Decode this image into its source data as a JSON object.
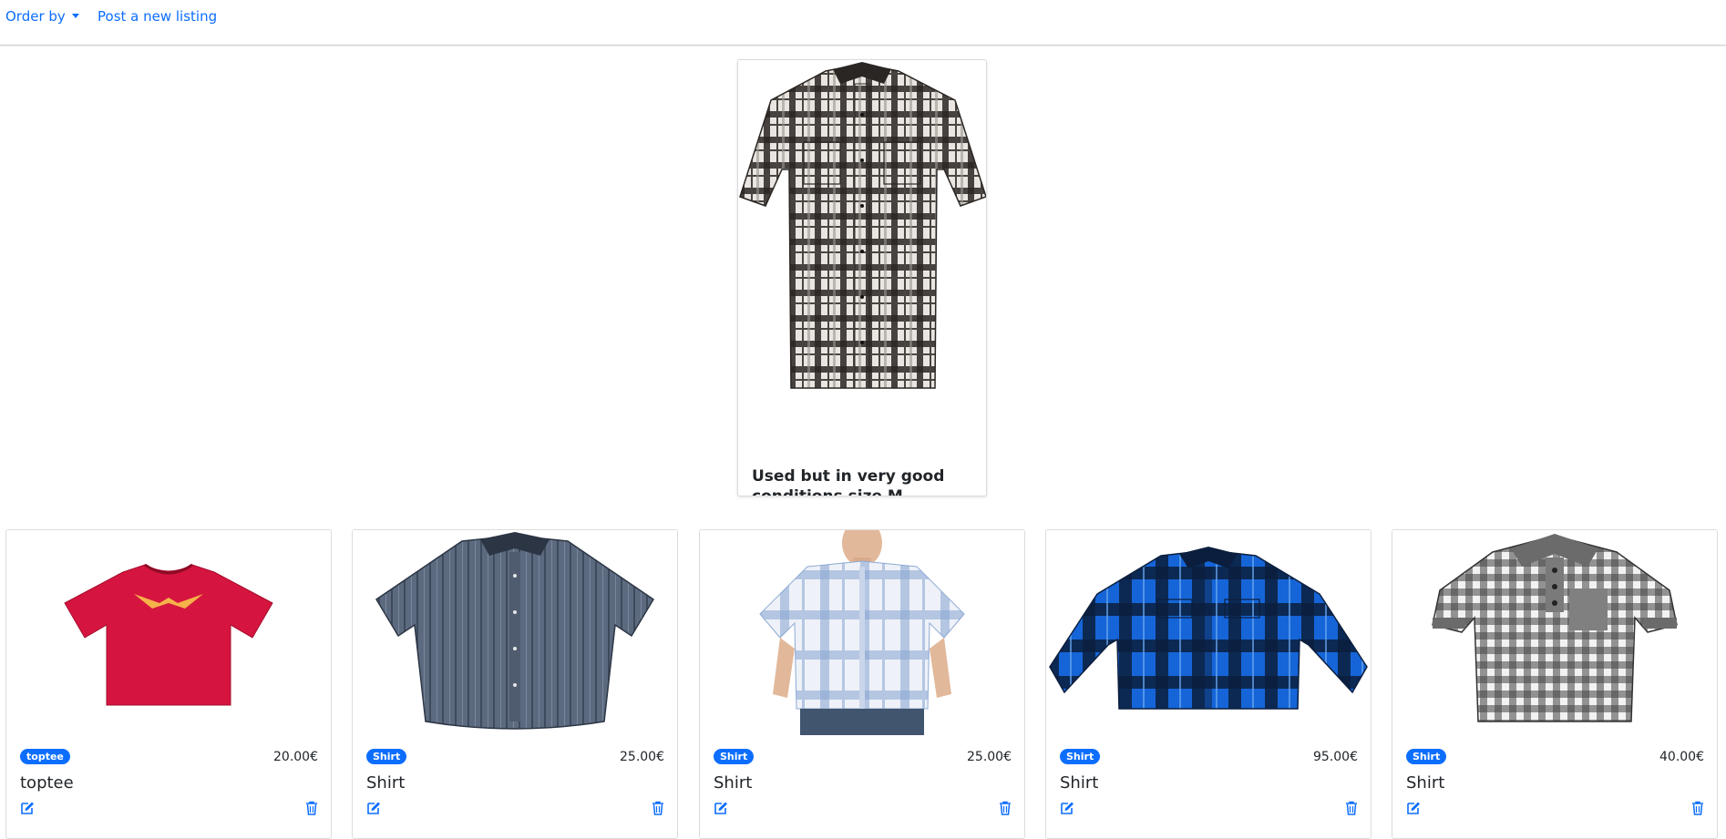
{
  "nav": {
    "order_by_label": "Order by",
    "post_listing_label": "Post a new listing"
  },
  "colors": {
    "accent": "#0d6efd",
    "text": "#212529"
  },
  "featured": {
    "title": "Used but in very good conditions size M",
    "image_icon": "plaid-short-sleeve-shirt-image",
    "chat_icon": "comment-icon",
    "edit_icon": "edit-icon"
  },
  "listings": [
    {
      "tag": "toptee",
      "price": "20.00€",
      "title": "toptee",
      "image_icon": "red-tshirt-image"
    },
    {
      "tag": "Shirt",
      "price": "25.00€",
      "title": "Shirt",
      "image_icon": "grey-blue-shirt-image"
    },
    {
      "tag": "Shirt",
      "price": "25.00€",
      "title": "Shirt",
      "image_icon": "light-plaid-shirt-on-model-image"
    },
    {
      "tag": "Shirt",
      "price": "95.00€",
      "title": "Shirt",
      "image_icon": "blue-flannel-shirt-image"
    },
    {
      "tag": "Shirt",
      "price": "40.00€",
      "title": "Shirt",
      "image_icon": "gingham-polo-shirt-image"
    }
  ]
}
